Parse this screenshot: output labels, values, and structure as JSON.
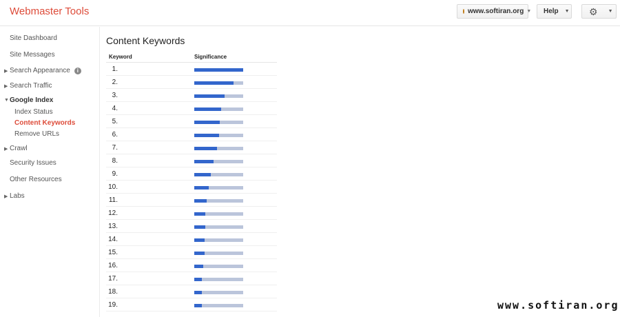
{
  "header": {
    "title": "Webmaster Tools",
    "site": "www.softiran.org",
    "help_label": "Help",
    "settings_icon": "gear-icon"
  },
  "sidebar": {
    "items": [
      {
        "label": "Site Dashboard"
      },
      {
        "label": "Site Messages"
      },
      {
        "label": "Search Appearance"
      },
      {
        "label": "Search Traffic"
      },
      {
        "label": "Google Index"
      },
      {
        "label": "Index Status"
      },
      {
        "label": "Content Keywords"
      },
      {
        "label": "Remove URLs"
      },
      {
        "label": "Crawl"
      },
      {
        "label": "Security Issues"
      },
      {
        "label": "Other Resources"
      },
      {
        "label": "Labs"
      }
    ],
    "active": "Content Keywords",
    "active_color": "#dd4b39"
  },
  "main": {
    "title": "Content Keywords",
    "columns": [
      "Keyword",
      "Significance"
    ],
    "rows": [
      {
        "rank": "1.",
        "keyword": "",
        "significance": 1.0
      },
      {
        "rank": "2.",
        "keyword": "",
        "significance": 0.8
      },
      {
        "rank": "3.",
        "keyword": "",
        "significance": 0.62
      },
      {
        "rank": "4.",
        "keyword": "",
        "significance": 0.55
      },
      {
        "rank": "5.",
        "keyword": "",
        "significance": 0.52
      },
      {
        "rank": "6.",
        "keyword": "",
        "significance": 0.5
      },
      {
        "rank": "7.",
        "keyword": "",
        "significance": 0.47
      },
      {
        "rank": "8.",
        "keyword": "",
        "significance": 0.39
      },
      {
        "rank": "9.",
        "keyword": "",
        "significance": 0.34
      },
      {
        "rank": "10.",
        "keyword": "",
        "significance": 0.3
      },
      {
        "rank": "11.",
        "keyword": "",
        "significance": 0.26
      },
      {
        "rank": "12.",
        "keyword": "",
        "significance": 0.23
      },
      {
        "rank": "13.",
        "keyword": "",
        "significance": 0.22
      },
      {
        "rank": "14.",
        "keyword": "",
        "significance": 0.21
      },
      {
        "rank": "15.",
        "keyword": "",
        "significance": 0.21
      },
      {
        "rank": "16.",
        "keyword": "",
        "significance": 0.19
      },
      {
        "rank": "17.",
        "keyword": "",
        "significance": 0.16
      },
      {
        "rank": "18.",
        "keyword": "",
        "significance": 0.16
      },
      {
        "rank": "19.",
        "keyword": "",
        "significance": 0.15
      }
    ],
    "bar_color": "#3366cc",
    "bar_bg_color": "#bbc5db"
  },
  "watermark": "www.softiran.org"
}
